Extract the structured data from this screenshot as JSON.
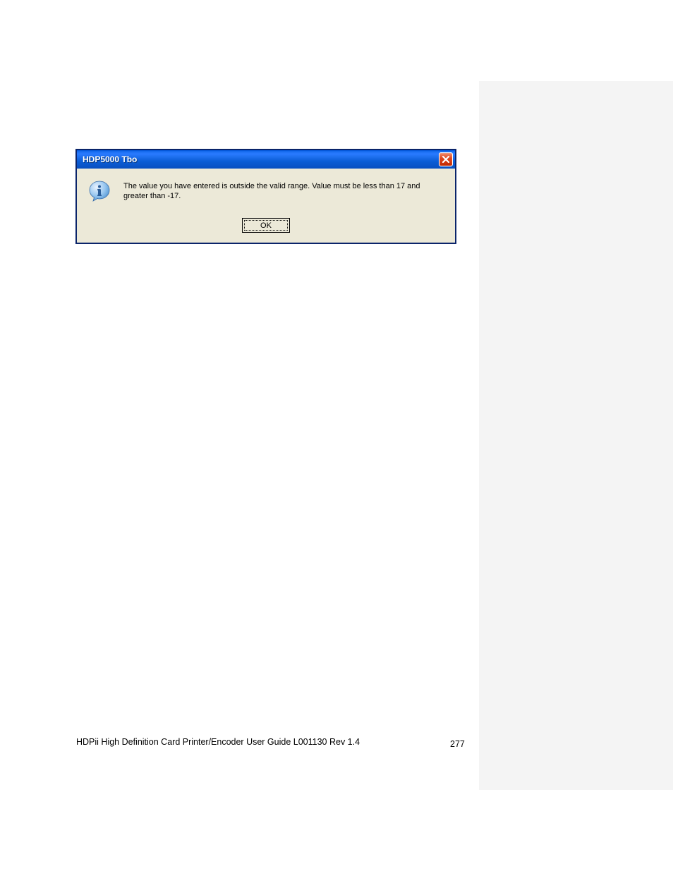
{
  "dialog": {
    "title": "HDP5000 Tbo",
    "message": "The value you have entered is outside the valid range. Value must be less than 17 and greater than -17.",
    "ok_label": "OK"
  },
  "footer": {
    "guide_text": "HDPii High Definition Card Printer/Encoder User Guide    L001130 Rev 1.4",
    "page_number": "277"
  }
}
